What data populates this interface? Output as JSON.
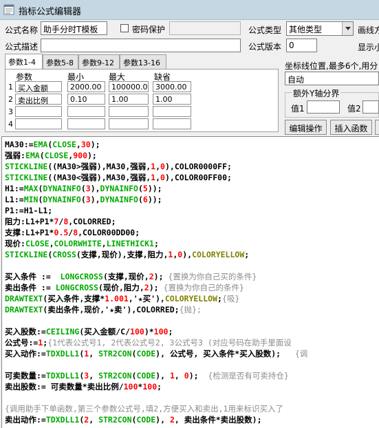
{
  "window": {
    "title": "指标公式编辑器"
  },
  "form": {
    "name_label": "公式名称",
    "name_value": "助手分时T模板",
    "password_label": "密码保护",
    "type_label": "公式类型",
    "type_value": "其他类型",
    "draw_method_label": "画线方",
    "desc_label": "公式描述",
    "version_label": "公式版本",
    "version_value": "0",
    "display_label": "显示小"
  },
  "tabs": [
    "参数1-4",
    "参数5-8",
    "参数9-12",
    "参数13-16"
  ],
  "params": {
    "headers": {
      "name": "参数",
      "min": "最小",
      "max": "最大",
      "default": "缺省"
    },
    "rows": [
      {
        "num": "1",
        "name": "买入金额",
        "min": "2000.00",
        "max": "100000.00",
        "default": "3000.00"
      },
      {
        "num": "2",
        "name": "卖出比例",
        "min": "0.10",
        "max": "1.00",
        "default": "1.00"
      },
      {
        "num": "3",
        "name": "",
        "min": "",
        "max": "",
        "default": ""
      },
      {
        "num": "4",
        "name": "",
        "min": "",
        "max": "",
        "default": ""
      }
    ]
  },
  "right_panel": {
    "coord_label": "坐标线位置,最多6个,用分",
    "coord_value": "自动",
    "extra_y_label": "额外Y轴分界",
    "value1_label": "值1",
    "value2_label": "值2",
    "edit_button": "编辑操作",
    "insert_button": "插入函数"
  },
  "colors": {
    "titlebar": "#c6d7e4",
    "code_default": "#000000",
    "code_function": "#00aa00",
    "code_number": "#ff0000",
    "code_comment": "#8c8c8c",
    "code_constant": "#808000"
  },
  "code": [
    [
      [
        "MA30:=",
        "k"
      ],
      [
        "EMA",
        "f"
      ],
      [
        "(",
        "k"
      ],
      [
        "CLOSE",
        "f"
      ],
      [
        ",",
        "k"
      ],
      [
        "30",
        "n"
      ],
      [
        ");",
        "k"
      ]
    ],
    [
      [
        "强弱:",
        "k"
      ],
      [
        "EMA",
        "f"
      ],
      [
        "(",
        "k"
      ],
      [
        "CLOSE",
        "f"
      ],
      [
        ",",
        "k"
      ],
      [
        "900",
        "n"
      ],
      [
        ");",
        "k"
      ]
    ],
    [
      [
        "STICKLINE",
        "f"
      ],
      [
        "((MA30>强弱),MA30,强弱,",
        "k"
      ],
      [
        "1",
        "n"
      ],
      [
        ",",
        "k"
      ],
      [
        "0",
        "n"
      ],
      [
        "),COLOR0000FF;",
        "k"
      ]
    ],
    [
      [
        "STICKLINE",
        "f"
      ],
      [
        "((MA30<强弱),MA30,强弱,",
        "k"
      ],
      [
        "1",
        "n"
      ],
      [
        ",",
        "k"
      ],
      [
        "0",
        "n"
      ],
      [
        "),COLOR00FF00;",
        "k"
      ]
    ],
    [
      [
        "H1:=",
        "k"
      ],
      [
        "MAX",
        "f"
      ],
      [
        "(",
        "k"
      ],
      [
        "DYNAINFO",
        "f"
      ],
      [
        "(",
        "k"
      ],
      [
        "3",
        "n"
      ],
      [
        "),",
        "k"
      ],
      [
        "DYNAINFO",
        "f"
      ],
      [
        "(",
        "k"
      ],
      [
        "5",
        "n"
      ],
      [
        "));",
        "k"
      ]
    ],
    [
      [
        "L1:=",
        "k"
      ],
      [
        "MIN",
        "f"
      ],
      [
        "(",
        "k"
      ],
      [
        "DYNAINFO",
        "f"
      ],
      [
        "(",
        "k"
      ],
      [
        "3",
        "n"
      ],
      [
        "),",
        "k"
      ],
      [
        "DYNAINFO",
        "f"
      ],
      [
        "(",
        "k"
      ],
      [
        "6",
        "n"
      ],
      [
        "));",
        "k"
      ]
    ],
    [
      [
        "P1:=H1-L1;",
        "k"
      ]
    ],
    [
      [
        "阻力:L1+P1*",
        "k"
      ],
      [
        "7",
        "n"
      ],
      [
        "/",
        "k"
      ],
      [
        "8",
        "n"
      ],
      [
        ",COLORRED;",
        "k"
      ]
    ],
    [
      [
        "支撑:L1+P1*",
        "k"
      ],
      [
        "0.5",
        "n"
      ],
      [
        "/",
        "k"
      ],
      [
        "8",
        "n"
      ],
      [
        ",COLOR00DD00;",
        "k"
      ]
    ],
    [
      [
        "现价:",
        "k"
      ],
      [
        "CLOSE",
        "f"
      ],
      [
        ",",
        "k"
      ],
      [
        "COLORWHITE",
        "f"
      ],
      [
        ",",
        "k"
      ],
      [
        "LINETHICK1",
        "f"
      ],
      [
        ";",
        "k"
      ]
    ],
    [
      [
        "STICKLINE",
        "f"
      ],
      [
        "(",
        "k"
      ],
      [
        "CROSS",
        "f"
      ],
      [
        "(支撑,现价),支撑,阻力,",
        "k"
      ],
      [
        "1",
        "n"
      ],
      [
        ",",
        "k"
      ],
      [
        "0",
        "n"
      ],
      [
        "),",
        "k"
      ],
      [
        "COLORYELLOW",
        "c"
      ],
      [
        ";",
        "k"
      ]
    ],
    [
      [
        "",
        "k"
      ]
    ],
    [
      [
        "买入条件 :=  ",
        "k"
      ],
      [
        "LONGCROSS",
        "f"
      ],
      [
        "(支撑,现价,",
        "k"
      ],
      [
        "2",
        "n"
      ],
      [
        ");",
        "k"
      ],
      [
        " {置换为你自己买的条件}",
        "g"
      ]
    ],
    [
      [
        "卖出条件 := ",
        "k"
      ],
      [
        "LONGCROSS",
        "f"
      ],
      [
        "(现价,阻力,",
        "k"
      ],
      [
        "2",
        "n"
      ],
      [
        ");",
        "k"
      ],
      [
        " {置换为你自己的条件}",
        "g"
      ]
    ],
    [
      [
        "DRAWTEXT",
        "f"
      ],
      [
        "(买入条件,支撑*",
        "k"
      ],
      [
        "1.001",
        "n"
      ],
      [
        ",'★买'),",
        "k"
      ],
      [
        "COLORYELLOW",
        "c"
      ],
      [
        ";",
        "k"
      ],
      [
        "{吸}",
        "g"
      ]
    ],
    [
      [
        "DRAWTEXT",
        "f"
      ],
      [
        "(卖出条件,现价,'★卖'),COLORRED;",
        "k"
      ],
      [
        "{抛};",
        "g"
      ]
    ],
    [
      [
        "",
        "k"
      ]
    ],
    [
      [
        "买入股数:=",
        "k"
      ],
      [
        "CEILING",
        "f"
      ],
      [
        "(买入金额/C/",
        "k"
      ],
      [
        "100",
        "n"
      ],
      [
        ")*",
        "k"
      ],
      [
        "100",
        "n"
      ],
      [
        ";",
        "k"
      ]
    ],
    [
      [
        "公式号:=",
        "k"
      ],
      [
        "1",
        "n"
      ],
      [
        ";",
        "k"
      ],
      [
        "{1代表公式号1, 2代表公式号2, 3公式号3 (对应号码在助手里面设",
        "g"
      ]
    ],
    [
      [
        "买入动作:=",
        "k"
      ],
      [
        "TDXDLL1",
        "f"
      ],
      [
        "(",
        "k"
      ],
      [
        "1",
        "n"
      ],
      [
        ", ",
        "k"
      ],
      [
        "STR2CON",
        "f"
      ],
      [
        "(",
        "k"
      ],
      [
        "CODE",
        "f"
      ],
      [
        "), 公式号, 买入条件*买入股数);   ",
        "k"
      ],
      [
        "{调",
        "g"
      ]
    ],
    [
      [
        "",
        "k"
      ]
    ],
    [
      [
        "可卖数量:=",
        "k"
      ],
      [
        "TDXDLL1",
        "f"
      ],
      [
        "(",
        "k"
      ],
      [
        "3",
        "n"
      ],
      [
        ", ",
        "k"
      ],
      [
        "STR2CON",
        "f"
      ],
      [
        "(",
        "k"
      ],
      [
        "CODE",
        "f"
      ],
      [
        "), ",
        "k"
      ],
      [
        "1",
        "n"
      ],
      [
        ", ",
        "k"
      ],
      [
        "0",
        "n"
      ],
      [
        ");  ",
        "k"
      ],
      [
        "{检测是否有可卖持仓}",
        "g"
      ]
    ],
    [
      [
        "卖出股数:= 可卖数量*卖出比例/",
        "k"
      ],
      [
        "100",
        "n"
      ],
      [
        "*",
        "k"
      ],
      [
        "100",
        "n"
      ],
      [
        ";",
        "k"
      ]
    ],
    [
      [
        "",
        "k"
      ]
    ],
    [
      [
        "{调用助手下单函数,第三个参数公式号,填2,方便买入和卖出,1用来标识买入了",
        "g"
      ]
    ],
    [
      [
        "卖出动作:=",
        "k"
      ],
      [
        "TDXDLL1",
        "f"
      ],
      [
        "(",
        "k"
      ],
      [
        "2",
        "n"
      ],
      [
        ", ",
        "k"
      ],
      [
        "STR2CON",
        "f"
      ],
      [
        "(",
        "k"
      ],
      [
        "CODE",
        "f"
      ],
      [
        "), ",
        "k"
      ],
      [
        "2",
        "n"
      ],
      [
        ", 卖出条件*卖出股数);",
        "k"
      ]
    ]
  ]
}
